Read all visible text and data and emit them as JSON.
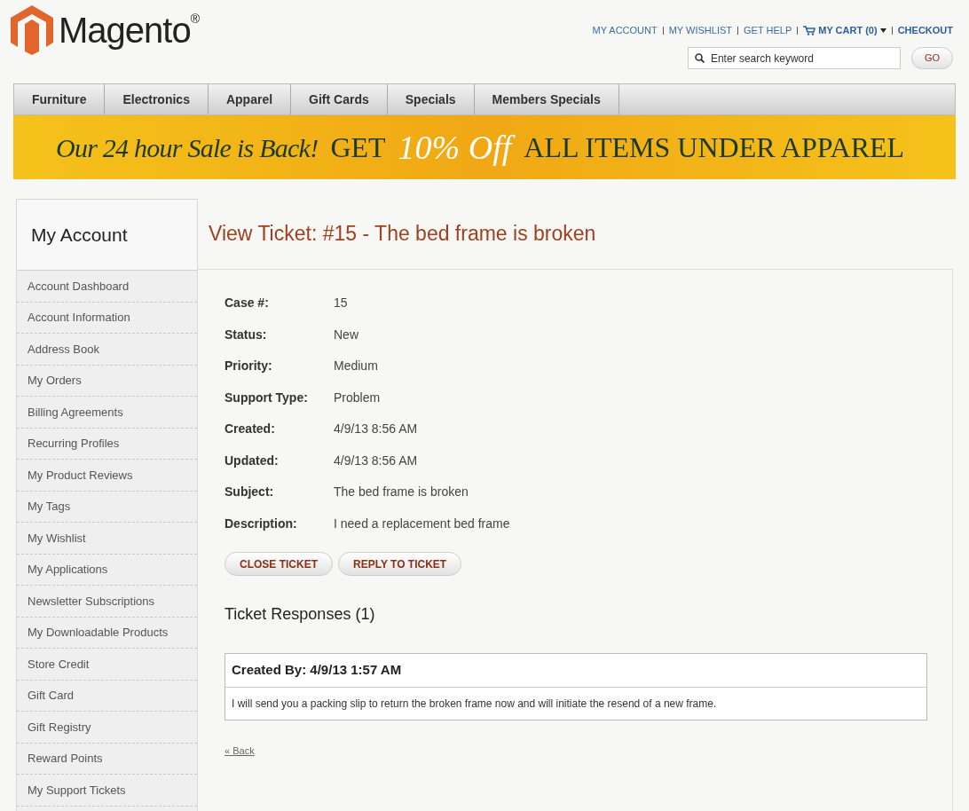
{
  "header": {
    "logo": "Magento",
    "logo_mark": "®",
    "links": [
      {
        "kind": "link",
        "label": "MY ACCOUNT"
      },
      {
        "kind": "link",
        "label": "MY WISHLIST"
      },
      {
        "kind": "link",
        "label": "GET HELP"
      },
      {
        "kind": "cart",
        "label": "MY CART (0)"
      },
      {
        "kind": "link",
        "label": "CHECKOUT"
      }
    ],
    "search": {
      "placeholder": "Enter search keyword",
      "button": "GO"
    }
  },
  "nav": [
    "Furniture",
    "Electronics",
    "Apparel",
    "Gift Cards",
    "Specials",
    "Members Specials"
  ],
  "banner": [
    {
      "kind": "script",
      "text": "Our 24 hour Sale is Back!"
    },
    {
      "kind": "serif",
      "text": "GET"
    },
    {
      "kind": "highlight",
      "text": "10% Off"
    },
    {
      "kind": "serif",
      "text": "ALL ITEMS UNDER APPAREL"
    }
  ],
  "sidebar": {
    "title": "My Account",
    "items": [
      "Account Dashboard",
      "Account Information",
      "Address Book",
      "My Orders",
      "Billing Agreements",
      "Recurring Profiles",
      "My Product Reviews",
      "My Tags",
      "My Wishlist",
      "My Applications",
      "Newsletter Subscriptions",
      "My Downloadable Products",
      "Store Credit",
      "Gift Card",
      "Gift Registry",
      "Reward Points",
      "My Support Tickets"
    ]
  },
  "ticket": {
    "title": "View Ticket: #15 - The bed frame is broken",
    "fields": [
      {
        "label": "Case #:",
        "value": "15"
      },
      {
        "label": "Status:",
        "value": "New"
      },
      {
        "label": "Priority:",
        "value": "Medium"
      },
      {
        "label": "Support Type:",
        "value": "Problem"
      },
      {
        "label": "Created:",
        "value": "4/9/13 8:56 AM"
      },
      {
        "label": "Updated:",
        "value": "4/9/13 8:56 AM"
      },
      {
        "label": "Subject:",
        "value": "The bed frame is broken"
      },
      {
        "label": "Description:",
        "value": "I need a replacement bed frame"
      }
    ],
    "buttons": [
      "CLOSE TICKET",
      "REPLY TO TICKET"
    ],
    "responses_title": "Ticket Responses (1)",
    "responses": [
      {
        "header": "Created By: 4/9/13 1:57 AM",
        "body": "I will send you a packing slip to return the broken frame now and will initiate the resend of a new frame."
      }
    ],
    "back_link": "« Back"
  }
}
